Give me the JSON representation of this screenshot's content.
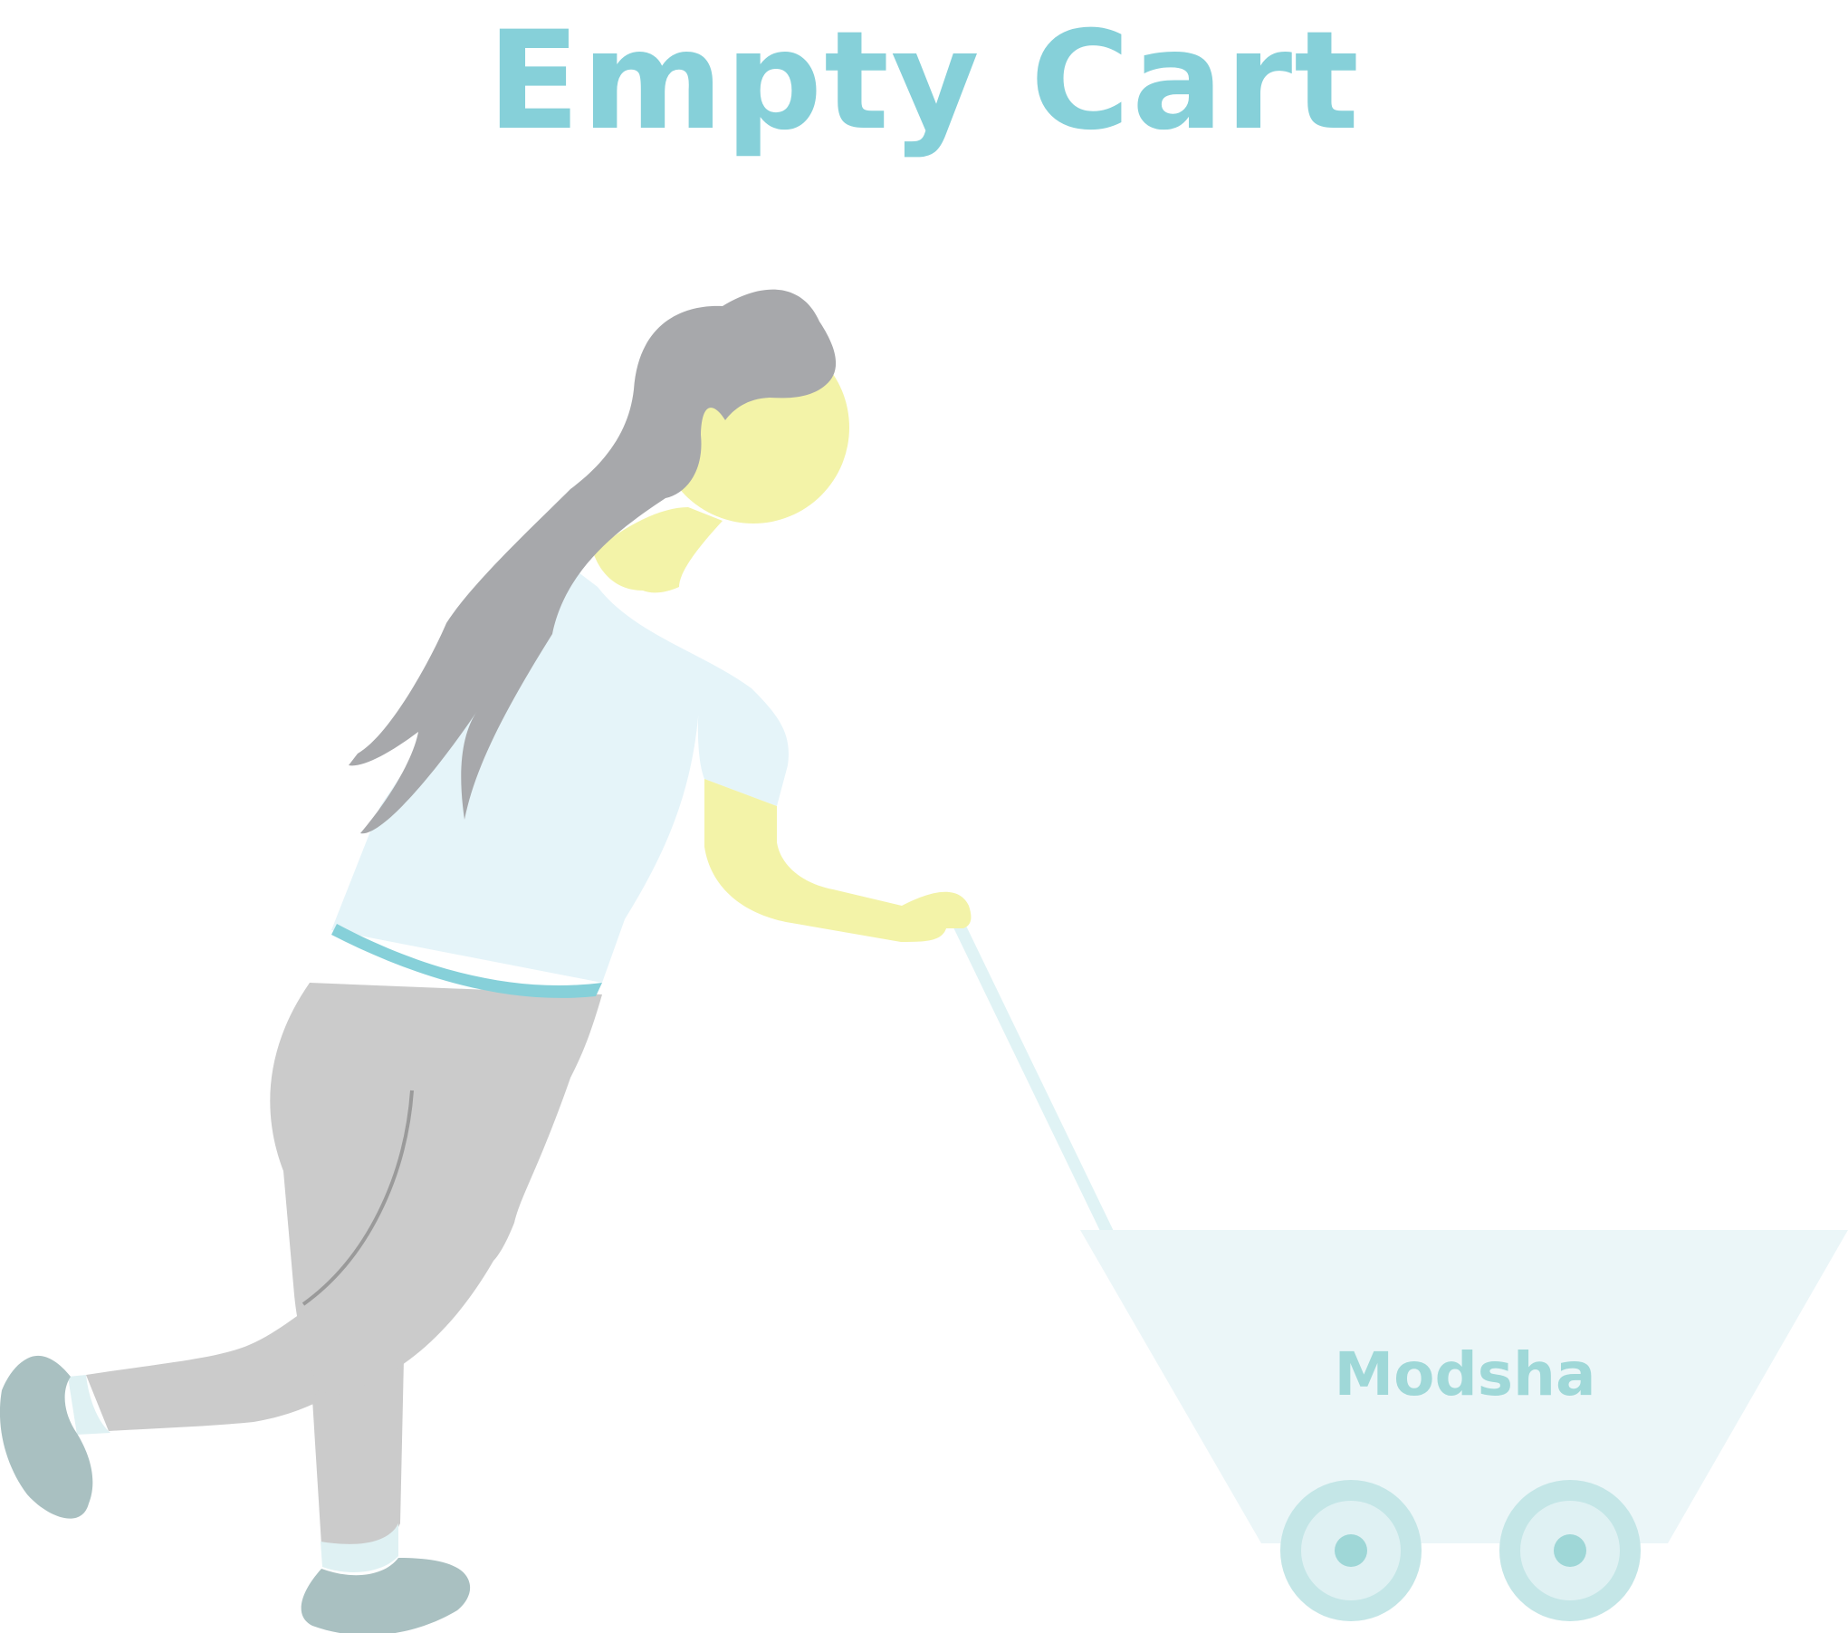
{
  "title": "Empty Cart",
  "cart": {
    "brand": "Modsha"
  },
  "colors": {
    "title": "#86d0d9",
    "skin": "#f3f3a8",
    "hair": "#a7a8ab",
    "shirt": "#e5f4f9",
    "pants": "#cbcbcb",
    "shoes": "#a9c0c1",
    "cart": "#ebf6f8",
    "wheel_outer": "#c4e6e7",
    "wheel_inner": "#dff1f3",
    "wheel_hub": "#9fd7d7",
    "brand_text": "#9fd8d8"
  }
}
